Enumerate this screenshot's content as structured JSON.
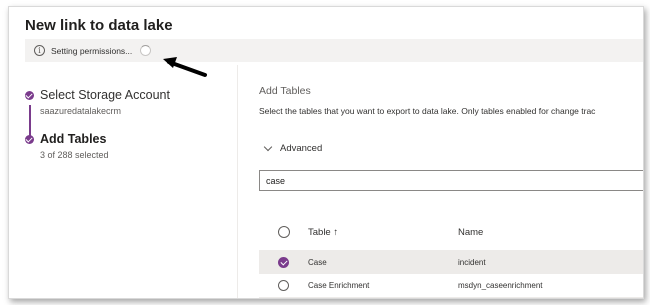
{
  "dialog": {
    "title": "New link to data lake",
    "status": {
      "icon": "info-icon",
      "text": "Setting permissions...",
      "spinner": "loading-spinner-icon"
    },
    "annotation": {
      "icon": "arrow-pointer-icon",
      "color": "#000000"
    }
  },
  "steps": [
    {
      "title": "Select Storage Account",
      "subtitle": "saazuredatalakecrm",
      "complete": true
    },
    {
      "title": "Add Tables",
      "subtitle": "3 of 288 selected",
      "current": true
    }
  ],
  "panel": {
    "heading": "Add Tables",
    "description": "Select the tables that you want to export to data lake. Only tables enabled for change trac",
    "advanced_label": "Advanced",
    "search_value": "case"
  },
  "table": {
    "columns": {
      "table": "Table ↑",
      "name": "Name"
    },
    "rows": [
      {
        "table": "Case",
        "name": "incident",
        "selected": true
      },
      {
        "table": "Case Enrichment",
        "name": "msdyn_caseenrichment",
        "selected": false
      }
    ]
  },
  "colors": {
    "accent": "#7a3b8c",
    "status_bar": "#f3f2f1",
    "selected_row": "#edebe9"
  }
}
